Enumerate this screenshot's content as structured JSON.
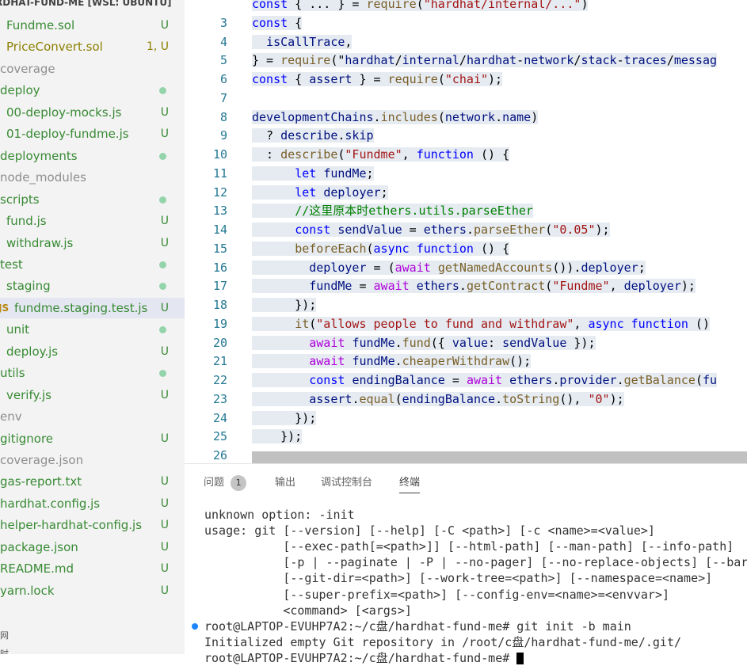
{
  "sidebar": {
    "header": "RDHAT-FUND-ME [WSL: UBUNTU]",
    "items": [
      {
        "name": "Fundme.sol",
        "badge": "U",
        "color": "green"
      },
      {
        "name": "PriceConvert.sol",
        "badge": "1, U",
        "color": "olive"
      },
      {
        "name": "coverage",
        "badge": "",
        "color": "gray"
      },
      {
        "name": "deploy",
        "badge": "",
        "color": "green",
        "dot": true
      },
      {
        "name": "00-deploy-mocks.js",
        "badge": "U",
        "color": "green"
      },
      {
        "name": "01-deploy-fundme.js",
        "badge": "U",
        "color": "green"
      },
      {
        "name": "deployments",
        "badge": "",
        "color": "green",
        "dot": true
      },
      {
        "name": "node_modules",
        "badge": "",
        "color": "gray"
      },
      {
        "name": "scripts",
        "badge": "",
        "color": "green",
        "dot": true
      },
      {
        "name": "fund.js",
        "badge": "U",
        "color": "green"
      },
      {
        "name": "withdraw.js",
        "badge": "U",
        "color": "green"
      },
      {
        "name": "test",
        "badge": "",
        "color": "green",
        "dot": true
      },
      {
        "name": "staging",
        "badge": "",
        "color": "green",
        "dot": true
      },
      {
        "name": "fundme.staging.test.js",
        "badge": "U",
        "color": "green",
        "selected": true,
        "icon": "JS"
      },
      {
        "name": "unit",
        "badge": "",
        "color": "green",
        "dot": true
      },
      {
        "name": "deploy.js",
        "badge": "U",
        "color": "green"
      },
      {
        "name": "utils",
        "badge": "",
        "color": "green",
        "dot": true
      },
      {
        "name": "verify.js",
        "badge": "U",
        "color": "green"
      },
      {
        "name": "env",
        "badge": "",
        "color": "gray"
      },
      {
        "name": "gitignore",
        "badge": "U",
        "color": "green"
      },
      {
        "name": "coverage.json",
        "badge": "",
        "color": "gray"
      },
      {
        "name": "gas-report.txt",
        "badge": "U",
        "color": "green"
      },
      {
        "name": "hardhat.config.js",
        "badge": "U",
        "color": "green"
      },
      {
        "name": "helper-hardhat-config.js",
        "badge": "U",
        "color": "green"
      },
      {
        "name": "package.json",
        "badge": "U",
        "color": "green"
      },
      {
        "name": "README.md",
        "badge": "U",
        "color": "green"
      },
      {
        "name": "yarn.lock",
        "badge": "U",
        "color": "green"
      }
    ],
    "footer1": "网",
    "footer2": "时"
  },
  "editor": {
    "lines": [
      {
        "n": "",
        "text": "const { ... } = require(\"hardhat/internal/...\")"
      },
      {
        "n": "3",
        "text": "const {"
      },
      {
        "n": "4",
        "text": "  isCallTrace,"
      },
      {
        "n": "5",
        "text": "} = require(\"hardhat/internal/hardhat-network/stack-traces/messag"
      },
      {
        "n": "6",
        "text": "const { assert } = require(\"chai\");"
      },
      {
        "n": "7",
        "text": ""
      },
      {
        "n": "8",
        "text": "developmentChains.includes(network.name)"
      },
      {
        "n": "9",
        "text": "  ? describe.skip"
      },
      {
        "n": "10",
        "text": "  : describe(\"Fundme\", function () {"
      },
      {
        "n": "11",
        "text": "      let fundMe;"
      },
      {
        "n": "12",
        "text": "      let deployer;"
      },
      {
        "n": "13",
        "text": "      //这里原本时ethers.utils.parseEther"
      },
      {
        "n": "14",
        "text": "      const sendValue = ethers.parseEther(\"0.05\");"
      },
      {
        "n": "15",
        "text": "      beforeEach(async function () {"
      },
      {
        "n": "16",
        "text": "        deployer = (await getNamedAccounts()).deployer;"
      },
      {
        "n": "17",
        "text": "        fundMe = await ethers.getContract(\"Fundme\", deployer);"
      },
      {
        "n": "18",
        "text": "      });"
      },
      {
        "n": "19",
        "text": "      it(\"allows people to fund and withdraw\", async function ()"
      },
      {
        "n": "20",
        "text": "        await fundMe.fund({ value: sendValue });"
      },
      {
        "n": "21",
        "text": "        await fundMe.cheaperWithdraw();"
      },
      {
        "n": "22",
        "text": "        const endingBalance = await ethers.provider.getBalance(fu"
      },
      {
        "n": "23",
        "text": "        assert.equal(endingBalance.toString(), \"0\");"
      },
      {
        "n": "24",
        "text": "      });"
      },
      {
        "n": "25",
        "text": "    });"
      },
      {
        "n": "26",
        "text": ""
      }
    ]
  },
  "panel": {
    "tabs": [
      {
        "label": "问题",
        "count": "1"
      },
      {
        "label": "输出"
      },
      {
        "label": "调试控制台"
      },
      {
        "label": "终端",
        "active": true
      }
    ],
    "terminal": [
      "unknown option: -init",
      "usage: git [--version] [--help] [-C <path>] [-c <name>=<value>]",
      "           [--exec-path[=<path>]] [--html-path] [--man-path] [--info-path]",
      "           [-p | --paginate | -P | --no-pager] [--no-replace-objects] [--bar",
      "           [--git-dir=<path>] [--work-tree=<path>] [--namespace=<name>]",
      "           [--super-prefix=<path>] [--config-env=<name>=<envvar>]",
      "           <command> [<args>]",
      "root@LAPTOP-EVUHP7A2:~/c盘/hardhat-fund-me# git init -b main",
      "Initialized empty Git repository in /root/c盘/hardhat-fund-me/.git/",
      "root@LAPTOP-EVUHP7A2:~/c盘/hardhat-fund-me# "
    ]
  }
}
